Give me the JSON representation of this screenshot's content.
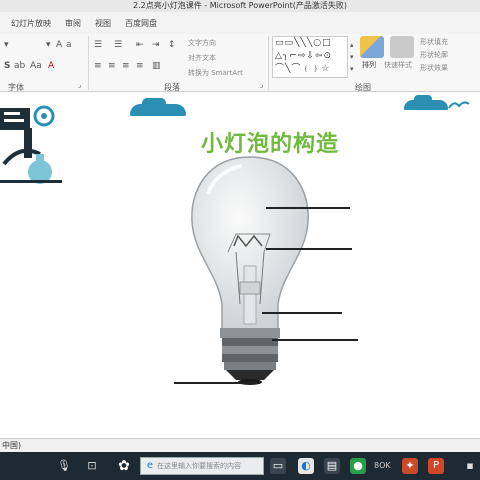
{
  "window": {
    "title": "2.2点亮小灯泡课件 - Microsoft PowerPoint(产品激活失败)"
  },
  "ribbon": {
    "tabs": [
      "幻灯片放映",
      "审阅",
      "视图",
      "百度网盘"
    ],
    "groups": {
      "font": "字体",
      "paragraph": "段落",
      "drawing": "绘图"
    },
    "paragraph_buttons": {
      "text_direction": "文字方向",
      "align_text": "对齐文本",
      "convert_smartart": "转换为 SmartArt"
    },
    "drawing_buttons": {
      "arrange": "排列",
      "quick_styles": "快速样式",
      "shape_fill": "形状填充",
      "shape_outline": "形状轮廓",
      "shape_effects": "形状效果"
    }
  },
  "slide": {
    "title": "小灯泡的构造"
  },
  "statusbar": {
    "language": "中国)"
  },
  "taskbar": {
    "search_placeholder": "在这里输入你要搜索的内容"
  },
  "colors": {
    "title_green": "#6fb93c",
    "cloud_blue": "#2b8fb4",
    "taskbar": "#1e2a33"
  }
}
